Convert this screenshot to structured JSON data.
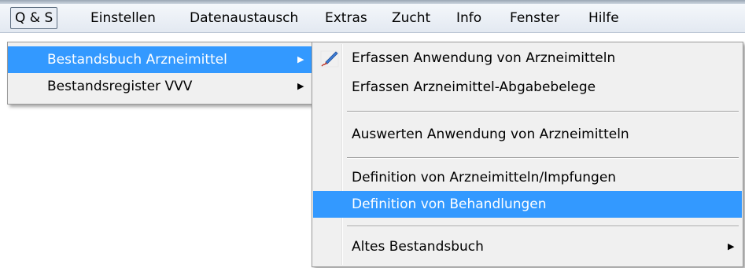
{
  "menubar": {
    "items": [
      "Q & S",
      "Einstellen",
      "Datenaustausch",
      "Extras",
      "Zucht",
      "Info",
      "Fenster",
      "Hilfe"
    ]
  },
  "menu1": {
    "items": [
      {
        "label": "Bestandsbuch Arzneimittel",
        "has_submenu": true,
        "highlighted": true
      },
      {
        "label": "Bestandsregister VVV",
        "has_submenu": true,
        "highlighted": false
      }
    ]
  },
  "menu2": {
    "items": [
      {
        "label": "Erfassen Anwendung von Arzneimitteln",
        "icon": "pen-icon"
      },
      {
        "label": "Erfassen Arzneimittel-Abgabebelege"
      },
      {
        "label": "Auswerten Anwendung von Arzneimitteln"
      },
      {
        "label": "Definition von Arzneimitteln/Impfungen"
      },
      {
        "label": "Definition von Behandlungen",
        "highlighted": true
      },
      {
        "label": "Altes Bestandsbuch",
        "has_submenu": true
      }
    ]
  },
  "colors": {
    "highlight": "#3399ff",
    "menu_bg": "#f0f0f0"
  }
}
